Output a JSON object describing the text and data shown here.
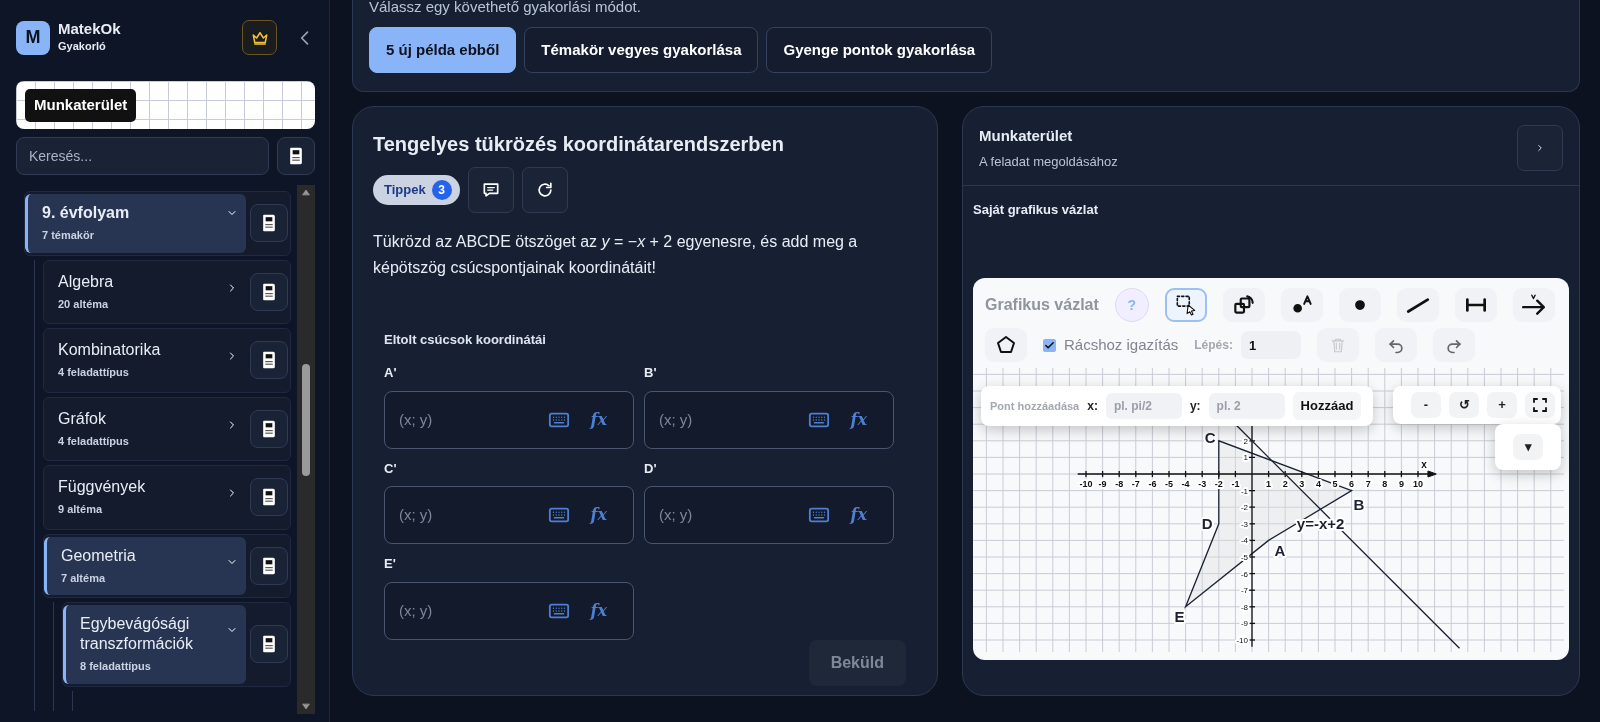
{
  "sidebar": {
    "logo_letter": "M",
    "app_name": "MatekOk",
    "app_subtitle": "Gyakorló",
    "workspace_tooltip": "Munkaterület",
    "search": {
      "placeholder": "Keresés..."
    },
    "tree": [
      {
        "label": "9. évfolyam",
        "count": "7 témakör",
        "expanded": true,
        "children": [
          {
            "label": "Algebra",
            "count": "20 altéma",
            "expanded": false
          },
          {
            "label": "Kombinatorika",
            "count": "4 feladattípus",
            "expanded": false
          },
          {
            "label": "Gráfok",
            "count": "4 feladattípus",
            "expanded": false
          },
          {
            "label": "Függvények",
            "count": "9 altéma",
            "expanded": false
          },
          {
            "label": "Geometria",
            "count": "7 altéma",
            "expanded": true,
            "children": [
              {
                "label": "Egybevágósági transzformációk",
                "count": "8 feladattípus",
                "expanded": true
              }
            ]
          }
        ]
      }
    ]
  },
  "modes": {
    "hint": "Válassz egy követhető gyakorlási módot.",
    "buttons": [
      {
        "label": "5 új példa ebből",
        "selected": true
      },
      {
        "label": "Témakör vegyes gyakorlása",
        "selected": false
      },
      {
        "label": "Gyenge pontok gyakorlása",
        "selected": false
      }
    ]
  },
  "problem": {
    "title": "Tengelyes tükrözés koordinátarendszerben",
    "tips_label": "Tippek",
    "tips_count": "3",
    "statement": "Tükrözd az ABCDE ötszöget az *y* = −*x* + 2 egyenesre, és add meg a képötszög csúcspontjainak koordinátáit!",
    "answers_title": "Eltolt csúcsok koordinátái",
    "fields": [
      {
        "label": "A'",
        "placeholder": "(x; y)",
        "formula_label": "fx"
      },
      {
        "label": "B'",
        "placeholder": "(x; y)",
        "formula_label": "fx"
      },
      {
        "label": "C'",
        "placeholder": "(x; y)",
        "formula_label": "fx"
      },
      {
        "label": "D'",
        "placeholder": "(x; y)",
        "formula_label": "fx"
      },
      {
        "label": "E'",
        "placeholder": "(x; y)",
        "formula_label": "fx"
      }
    ],
    "submit": {
      "label": "Beküld",
      "disabled": true
    }
  },
  "workspace": {
    "title": "Munkaterület",
    "subtitle": "A feladat megoldásához",
    "sketch_title": "Saját grafikus vázlat",
    "sketch": {
      "title": "Grafikus vázlat",
      "help": "?",
      "snap": {
        "label": "Rácshoz igazítás",
        "checked": true
      },
      "step_label": "Lépés:",
      "step_value": "1",
      "add_point": {
        "title": "Pont hozzáadása",
        "x_label": "x:",
        "x_placeholder": "pl. pi/2",
        "y_label": "y:",
        "y_placeholder": "pl. 2",
        "button": "Hozzáad"
      },
      "zoom_out": "-",
      "reset": "↺",
      "zoom_in": "+",
      "dropdown": "▾",
      "graph": {
        "x_ticks": [
          "-10",
          "-9",
          "-8",
          "-7",
          "-6",
          "-5",
          "-4",
          "-3",
          "-2",
          "-1",
          "1",
          "2",
          "3",
          "4",
          "5",
          "6",
          "7",
          "8",
          "9",
          "10"
        ],
        "y_ticks": [
          "2",
          "1",
          "-1",
          "-2",
          "-3",
          "-4",
          "-5",
          "-6",
          "-7",
          "-8",
          "-9",
          "-10"
        ],
        "axis_label": "x",
        "line_label": "y=-x+2",
        "vertices": [
          "A",
          "B",
          "C",
          "D",
          "E"
        ]
      }
    }
  }
}
